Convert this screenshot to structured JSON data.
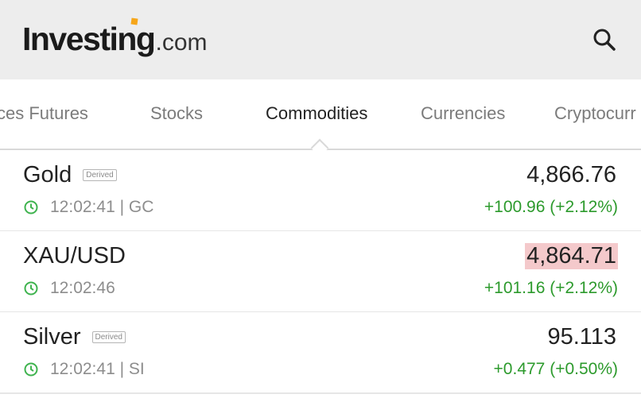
{
  "header": {
    "logo_main": "Investing",
    "logo_suffix": ".com",
    "accent_color": "#f6a61a"
  },
  "tabs": [
    {
      "label": "ces Futures"
    },
    {
      "label": "Stocks"
    },
    {
      "label": "Commodities",
      "active": true
    },
    {
      "label": "Currencies"
    },
    {
      "label": "Cryptocurr"
    }
  ],
  "rows": [
    {
      "name": "Gold",
      "badge": "Derived",
      "time": "12:02:41 | GC",
      "price": "4,866.76",
      "change": "+100.96 (+2.12%)",
      "flash": false
    },
    {
      "name": "XAU/USD",
      "badge": "",
      "time": "12:02:46",
      "price": "4,864.71",
      "change": "+101.16 (+2.12%)",
      "flash": true
    },
    {
      "name": "Silver",
      "badge": "Derived",
      "time": "12:02:41 | SI",
      "price": "95.113",
      "change": "+0.477 (+0.50%)",
      "flash": false
    }
  ],
  "colors": {
    "positive": "#2c9a2c",
    "flash_down": "#f4c9cb",
    "clock": "#3fb34f"
  },
  "icons": {
    "search": "search-icon",
    "clock": "clock-icon"
  }
}
